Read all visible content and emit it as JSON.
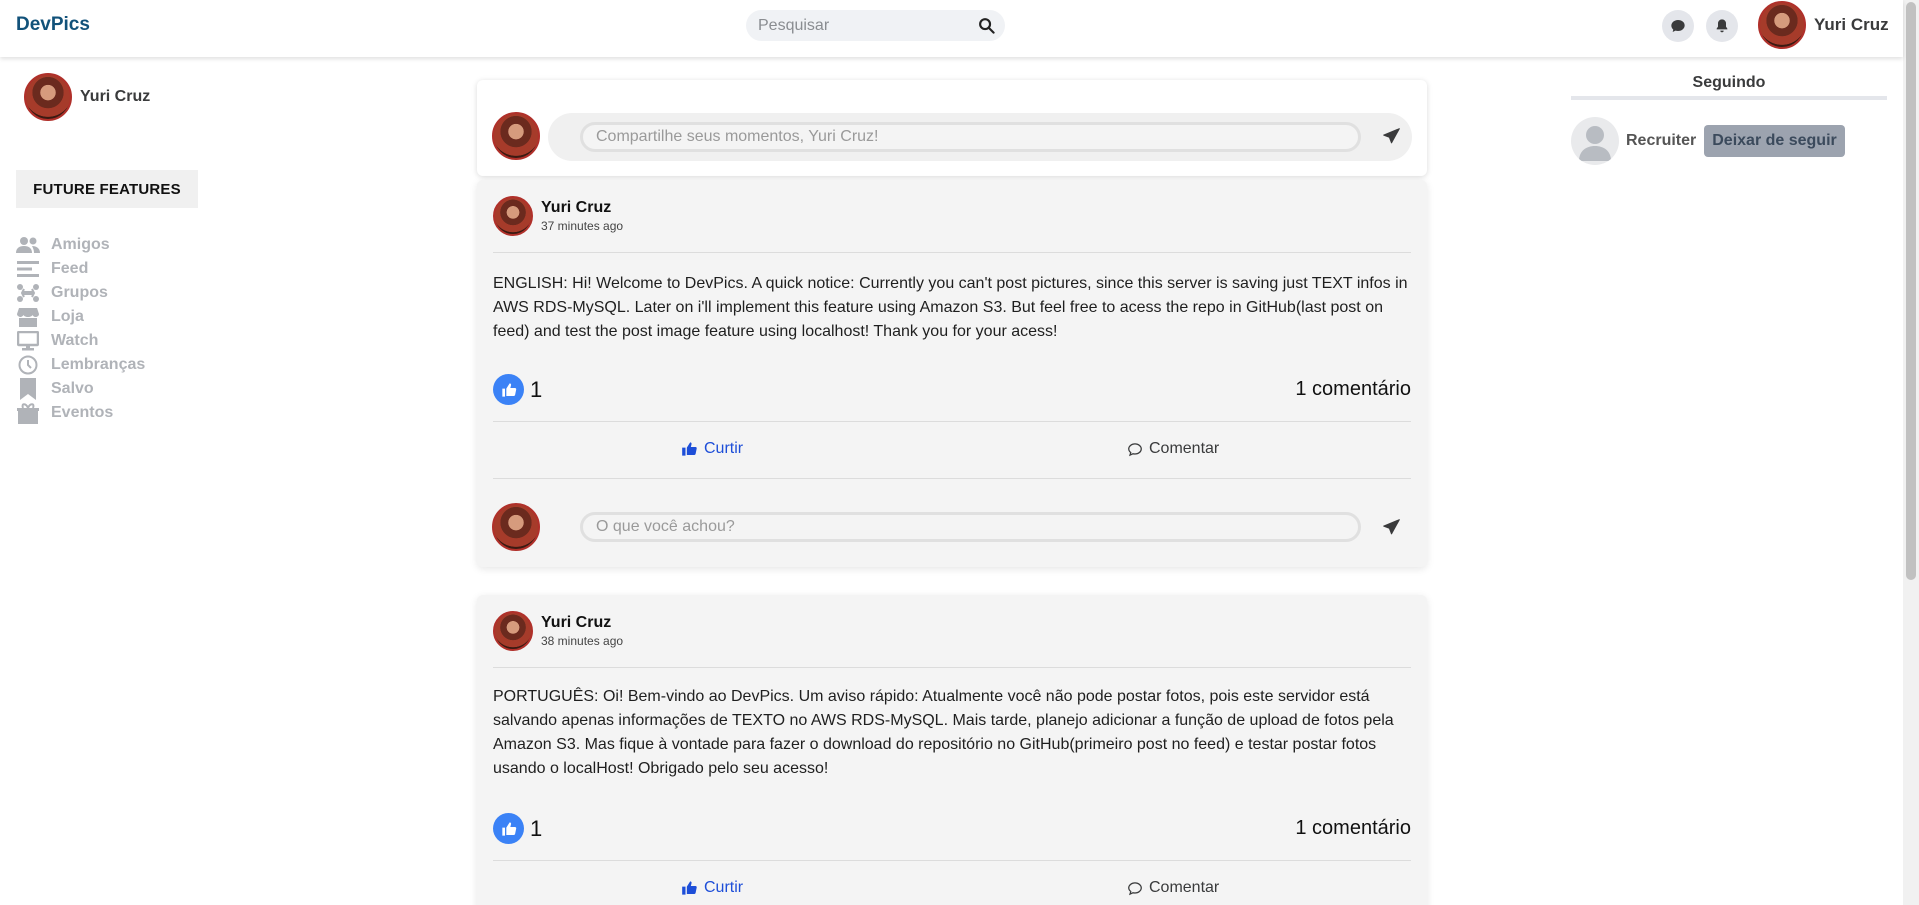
{
  "header": {
    "brand": "DevPics",
    "search_placeholder": "Pesquisar",
    "user_name": "Yuri Cruz"
  },
  "sidebar": {
    "user_name": "Yuri Cruz",
    "future_features_label": "FUTURE FEATURES",
    "items": [
      {
        "label": "Amigos",
        "icon": "friends-icon"
      },
      {
        "label": "Feed",
        "icon": "feed-icon"
      },
      {
        "label": "Grupos",
        "icon": "groups-icon"
      },
      {
        "label": "Loja",
        "icon": "store-icon"
      },
      {
        "label": "Watch",
        "icon": "watch-icon"
      },
      {
        "label": "Lembranças",
        "icon": "clock-icon"
      },
      {
        "label": "Salvo",
        "icon": "bookmark-icon"
      },
      {
        "label": "Eventos",
        "icon": "events-icon"
      }
    ]
  },
  "composer": {
    "placeholder": "Compartilhe seus momentos, Yuri Cruz!"
  },
  "posts": [
    {
      "author": "Yuri Cruz",
      "time": "37 minutes ago",
      "text": "ENGLISH: Hi! Welcome to DevPics. A quick notice: Currently you can't post pictures, since this server is saving just TEXT infos in AWS RDS-MySQL. Later on i'll implement this feature using Amazon S3. But feel free to acess the repo in GitHub(last post on feed) and test the post image feature using localhost! Thank you for your acess!",
      "likes": "1",
      "comments": "1 comentário",
      "like_label": "Curtir",
      "comment_label": "Comentar",
      "comment_placeholder": "O que você achou?"
    },
    {
      "author": "Yuri Cruz",
      "time": "38 minutes ago",
      "text": "PORTUGUÊS: Oi! Bem-vindo ao DevPics. Um aviso rápido: Atualmente você não pode postar fotos, pois este servidor está salvando apenas informações de TEXTO no AWS RDS-MySQL. Mais tarde, planejo adicionar a função de upload de fotos pela Amazon S3. Mas fique à vontade para fazer o download do repositório no GitHub(primeiro post no feed) e testar postar fotos usando o localHost! Obrigado pelo seu acesso!",
      "likes": "1",
      "comments": "1 comentário",
      "like_label": "Curtir",
      "comment_label": "Comentar"
    }
  ],
  "following": {
    "title": "Seguindo",
    "users": [
      {
        "name": "Recruiter",
        "action_label": "Deixar de seguir"
      }
    ]
  },
  "colors": {
    "brand": "#12527a",
    "like_blue": "#3b82f6",
    "link_blue": "#1d4ed8",
    "muted": "#b0b3b8"
  }
}
